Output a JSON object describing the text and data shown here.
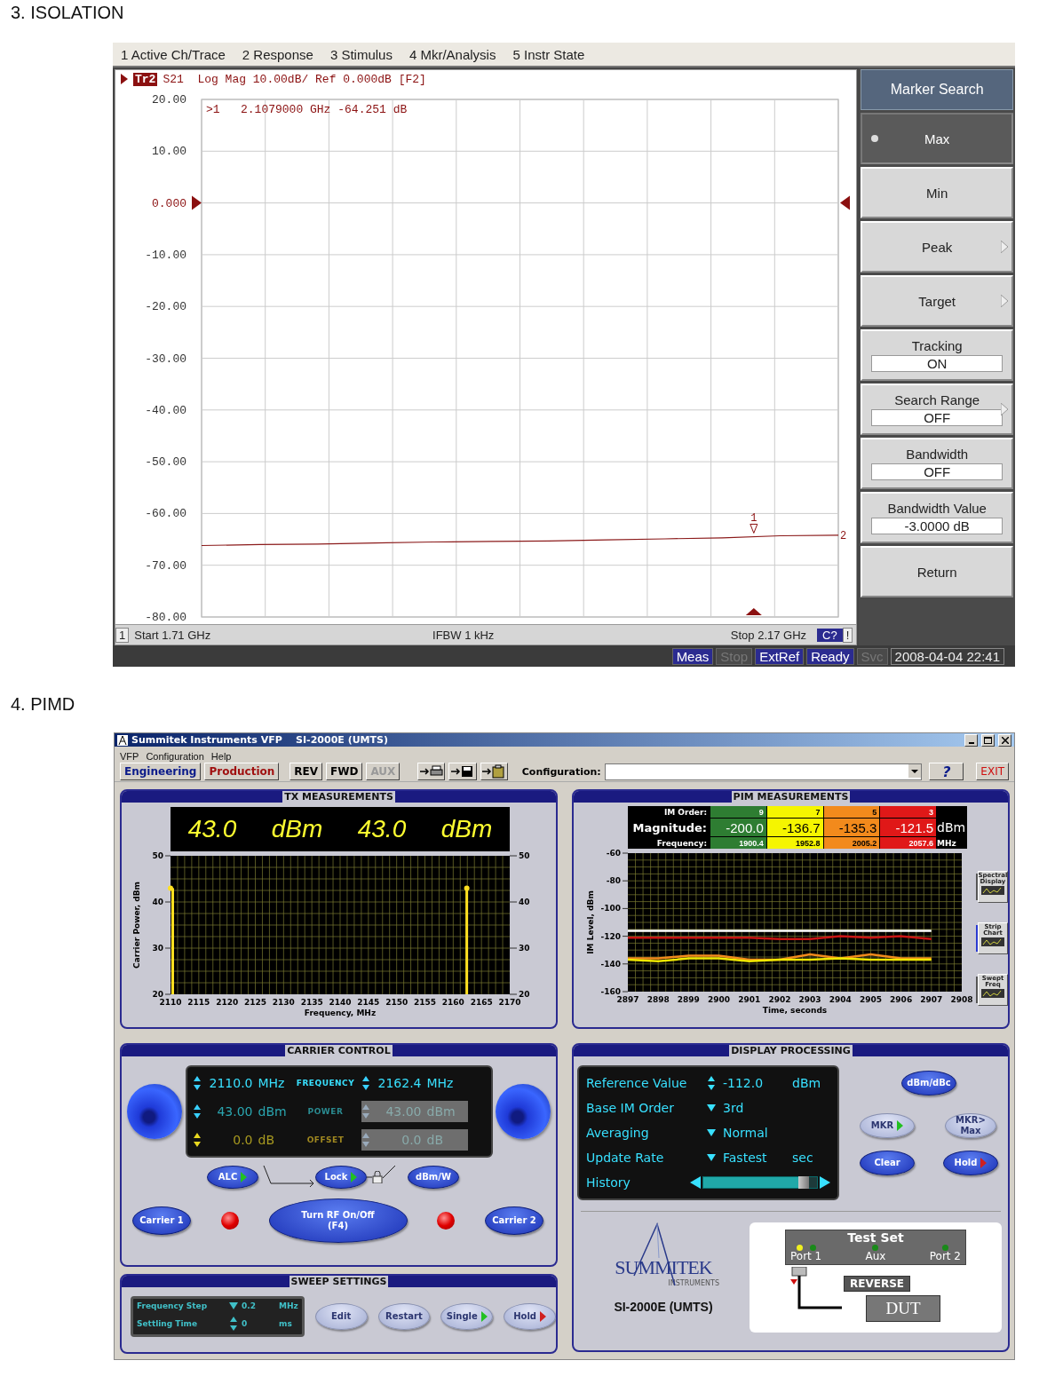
{
  "isolation_heading": "3. ISOLATION",
  "vna": {
    "menu": [
      "1 Active Ch/Trace",
      "2 Response",
      "3 Stimulus",
      "4 Mkr/Analysis",
      "5 Instr State"
    ],
    "trace_tag": "Tr2",
    "trace_header": "S21  Log Mag 10.00dB/ Ref 0.000dB [F2]",
    "marker_readout": ">1   2.1079000 GHz -64.251 dB",
    "marker_label": "1",
    "trace_number": "2",
    "chart_data": {
      "type": "line",
      "categories": [
        null,
        null,
        null,
        null,
        null,
        null,
        null,
        null,
        null,
        null,
        null,
        null
      ],
      "values": [
        -66.2,
        -66.0,
        -65.9,
        -65.7,
        -65.5,
        -65.4,
        -65.3,
        -65.1,
        -64.9,
        -64.7,
        -64.3,
        -64.2
      ],
      "ylim": [
        -80,
        20
      ],
      "grid": true,
      "yticks": [
        {
          "value": 20,
          "label": "20.00"
        },
        {
          "value": 10,
          "label": "10.00"
        },
        {
          "value": 0,
          "label": "0.000"
        },
        {
          "value": -10,
          "label": "-10.00"
        },
        {
          "value": -20,
          "label": "-20.00"
        },
        {
          "value": -30,
          "label": "-30.00"
        },
        {
          "value": -40,
          "label": "-40.00"
        },
        {
          "value": -50,
          "label": "-50.00"
        },
        {
          "value": -60,
          "label": "-60.00"
        },
        {
          "value": -70,
          "label": "-70.00"
        },
        {
          "value": -80,
          "label": "-80.00"
        }
      ]
    },
    "footer": {
      "channel": "1",
      "start": "Start 1.71 GHz",
      "ifbw": "IFBW 1 kHz",
      "stop": "Stop 2.17 GHz",
      "cal": "C?",
      "warning": "!"
    },
    "softkeys_title": "Marker Search",
    "softkeys": [
      {
        "kind": "button",
        "label": "Max",
        "selected": true,
        "arrow": false
      },
      {
        "kind": "button",
        "label": "Min",
        "selected": false,
        "arrow": false
      },
      {
        "kind": "button",
        "label": "Peak",
        "selected": false,
        "arrow": true
      },
      {
        "kind": "button",
        "label": "Target",
        "selected": false,
        "arrow": true
      },
      {
        "kind": "value",
        "label": "Tracking",
        "value": "ON",
        "selected": false,
        "arrow": false
      },
      {
        "kind": "value",
        "label": "Search Range",
        "value": "OFF",
        "selected": false,
        "arrow": true
      },
      {
        "kind": "value",
        "label": "Bandwidth",
        "value": "OFF",
        "selected": false,
        "arrow": false
      },
      {
        "kind": "value",
        "label": "Bandwidth Value",
        "value": "-3.0000 dB",
        "selected": false,
        "arrow": false
      },
      {
        "kind": "button",
        "label": "Return",
        "selected": false,
        "arrow": false
      }
    ],
    "status_bar": [
      {
        "label": "Meas",
        "active": true
      },
      {
        "label": "Stop",
        "active": false
      },
      {
        "label": "ExtRef",
        "active": true
      },
      {
        "label": "Ready",
        "active": true
      },
      {
        "label": "Svc",
        "active": false
      }
    ],
    "datetime": "2008-04-04 22:41"
  },
  "pimd_heading": "4. PIMD",
  "pim": {
    "title": "Summitek Instruments VFP    SI-2000E (UMTS)",
    "menu": [
      "VFP",
      "Configuration",
      "Help"
    ],
    "toolbar": [
      {
        "label": "Engineering",
        "color": "#0a1a8a",
        "disabled": false
      },
      {
        "label": "Production",
        "color": "#a01010",
        "disabled": false
      },
      {
        "label": "REV",
        "color": "#000000",
        "disabled": false
      },
      {
        "label": "FWD",
        "color": "#000000",
        "disabled": false
      },
      {
        "label": "AUX",
        "disabled": true
      }
    ],
    "configuration_label": "Configuration:",
    "help_button": "?",
    "exit_button": "EXIT",
    "tx": {
      "title": "TX MEASUREMENTS",
      "readouts": [
        {
          "value": "43.0",
          "unit": "dBm"
        },
        {
          "value": "43.0",
          "unit": "dBm"
        }
      ],
      "right_axis_labels": [
        "50",
        "40",
        "30",
        "20"
      ],
      "chart_data": {
        "type": "bar",
        "xlabel": "Frequency, MHz",
        "ylabel": "Carrier Power, dBm",
        "x": [
          2110,
          2162.4
        ],
        "values": [
          43,
          43
        ],
        "xlim": [
          2110,
          2170
        ],
        "ylim": [
          20,
          50
        ],
        "grid": true,
        "xticks": [
          2110,
          2115,
          2120,
          2125,
          2130,
          2135,
          2140,
          2145,
          2150,
          2155,
          2160,
          2165,
          2170
        ],
        "yticks": [
          20,
          30,
          40,
          50
        ]
      }
    },
    "pim_meas": {
      "title": "PIM MEASUREMENTS",
      "row_labels": [
        "IM Order:",
        "Magnitude:",
        "Frequency:"
      ],
      "columns": [
        {
          "order": "9",
          "magnitude": "-200.0",
          "frequency": "1900.4",
          "color": "#2e7d32"
        },
        {
          "order": "7",
          "magnitude": "-136.7",
          "frequency": "1952.8",
          "color": "#f5f500"
        },
        {
          "order": "5",
          "magnitude": "-135.3",
          "frequency": "2005.2",
          "color": "#f28a1c"
        },
        {
          "order": "3",
          "magnitude": "-121.5",
          "frequency": "2057.6",
          "color": "#e01818"
        }
      ],
      "magnitude_unit": "dBm",
      "frequency_unit": "MHz",
      "chart_data": {
        "type": "line",
        "xlabel": "Time, seconds",
        "ylabel": "IM Level, dBm",
        "x": [
          2897,
          2898,
          2899,
          2900,
          2901,
          2902,
          2903,
          2904,
          2905,
          2906,
          2907
        ],
        "series": [
          {
            "color": "#ffffff",
            "values": [
              -116,
              -116,
              -116,
              -116,
              -116,
              -116,
              -116,
              -116,
              -116,
              -116,
              -116
            ]
          },
          {
            "color": "#c81414",
            "values": [
              -121,
              -121,
              -121,
              -121,
              -121,
              -122,
              -122,
              -120,
              -121,
              -120,
              -122
            ]
          },
          {
            "color": "#f28a1c",
            "values": [
              -136,
              -136,
              -134,
              -134,
              -137,
              -137,
              -133,
              -136,
              -133,
              -136,
              -136
            ]
          },
          {
            "color": "#f0e800",
            "values": [
              -137,
              -138,
              -136,
              -136,
              -138,
              -137,
              -137,
              -136,
              -137,
              -137,
              -137
            ]
          }
        ],
        "xlim": [
          2897,
          2908
        ],
        "ylim": [
          -160,
          -60
        ],
        "grid": true,
        "xticks": [
          2897,
          2898,
          2899,
          2900,
          2901,
          2902,
          2903,
          2904,
          2905,
          2906,
          2907,
          2908
        ],
        "yticks": [
          -160,
          -140,
          -120,
          -100,
          -80,
          -60
        ]
      },
      "side_buttons": [
        {
          "label": "Spectral Display",
          "selected": false
        },
        {
          "label": "Strip Chart",
          "selected": true
        },
        {
          "label": "Swept Freq",
          "selected": false
        }
      ]
    },
    "carrier": {
      "title": "CARRIER CONTROL",
      "rows": [
        {
          "kind": "frequency",
          "label": "FREQUENCY",
          "left_value": "2110.0",
          "left_unit": "MHz",
          "right_value": "2162.4",
          "right_unit": "MHz",
          "right_disabled": false
        },
        {
          "kind": "power",
          "label": "POWER",
          "left_value": "43.00",
          "left_unit": "dBm",
          "right_value": "43.00",
          "right_unit": "dBm",
          "right_disabled": true
        },
        {
          "kind": "offset",
          "label": "OFFSET",
          "left_value": "0.0",
          "left_unit": "dB",
          "right_value": "0.0",
          "right_unit": "dB",
          "right_disabled": true
        }
      ],
      "top_buttons": [
        {
          "label": "ALC",
          "color": "#22c022"
        },
        {
          "label": "Lock",
          "color": "#22c022"
        },
        {
          "label": "dBm/W"
        }
      ],
      "bottom_buttons": [
        {
          "kind": "carrier",
          "label": "Carrier 1",
          "led_on": true
        },
        {
          "kind": "rf",
          "label": "Turn RF On/Off\n(F4)"
        },
        {
          "kind": "carrier",
          "label": "Carrier 2",
          "led_on": true
        }
      ]
    },
    "sweep": {
      "title": "SWEEP SETTINGS",
      "rows": [
        {
          "kind": "drop",
          "label": "Frequency Step",
          "value": "0.2",
          "unit": "MHz"
        },
        {
          "kind": "spin",
          "label": "Settling Time",
          "value": "0",
          "unit": "ms"
        }
      ],
      "buttons": [
        {
          "label": "Edit",
          "disabled": true
        },
        {
          "label": "Restart",
          "disabled": true
        },
        {
          "label": "Single",
          "disabled": true,
          "color": "#22c022"
        },
        {
          "label": "Hold",
          "disabled": true,
          "color": "#d02020"
        }
      ]
    },
    "display": {
      "title": "DISPLAY PROCESSING",
      "rows": [
        {
          "kind": "spin",
          "label": "Reference Value",
          "value": "-112.0",
          "unit": "dBm"
        },
        {
          "kind": "drop",
          "label": "Base IM Order",
          "value": "3rd"
        },
        {
          "kind": "drop",
          "label": "Averaging",
          "value": "Normal"
        },
        {
          "kind": "drop",
          "label": "Update Rate",
          "value": "Fastest",
          "unit": "sec"
        },
        {
          "kind": "slider",
          "label": "History",
          "level": 0.93
        }
      ],
      "buttons": [
        {
          "label": "dBm/dBc",
          "disabled": false
        },
        {
          "label": "MKR",
          "disabled": true,
          "color": "#22c022"
        },
        {
          "label": "MKR>\nMax",
          "disabled": true
        },
        {
          "label": "Clear",
          "disabled": false
        },
        {
          "label": "Hold",
          "disabled": false,
          "color": "#d02020"
        }
      ]
    },
    "logo": {
      "name": "SUMMITEK",
      "sub": "INSTRUMENTS",
      "model": "SI-2000E (UMTS)"
    },
    "test_set": {
      "title": "Test Set",
      "ports": [
        {
          "label": "Port 1",
          "active": true
        },
        {
          "label": "Aux",
          "active": false
        },
        {
          "label": "Port 2",
          "active": false
        }
      ],
      "button": "REVERSE",
      "dut": "DUT"
    }
  }
}
